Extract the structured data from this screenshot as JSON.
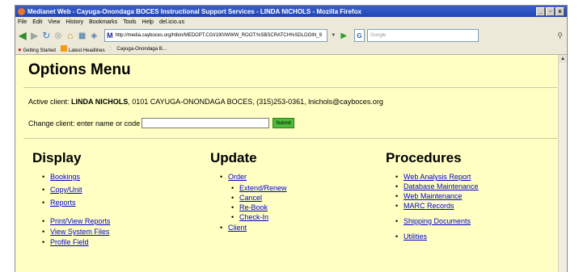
{
  "window": {
    "title": "Medianet Web - Cayuga-Onondaga BOCES Instructional Support Services - LINDA NICHOLS - Mozilla Firefox",
    "controls": [
      "_",
      "▫",
      "x"
    ]
  },
  "menubar": [
    "File",
    "Edit",
    "View",
    "History",
    "Bookmarks",
    "Tools",
    "Help",
    "del.icio.us"
  ],
  "toolbar": {
    "url": "http://media.cayboces.org/htbin/MEDOPT.CGI/190/WWW_ROOT:%SBSCRATCH%SDLOGIN_9",
    "search_placeholder": "Google"
  },
  "bookmarks": [
    "Getting Started",
    "Latest Headlines",
    "Cayuga-Onondaga B..."
  ],
  "page": {
    "title": "Options Menu",
    "active_client_label": "Active client:",
    "active_client_name": "LINDA NICHOLS",
    "active_client_details": ", 0101 CAYUGA-ONONDAGA BOCES, (315)253-0361, lnichols@cayboces.org",
    "change_client_label": "Change client: enter name or code",
    "change_client_value": "",
    "submit_label": "Submit"
  },
  "columns": {
    "display": {
      "heading": "Display",
      "items": [
        "Bookings",
        "Copy/Unit",
        "Reports",
        "Print/View Reports",
        "View System Files",
        "Profile Field"
      ]
    },
    "update": {
      "heading": "Update",
      "items": [
        "Order",
        "Extend/Renew",
        "Cancel",
        "Re-Book",
        "Check-In",
        "Client"
      ]
    },
    "procedures": {
      "heading": "Procedures",
      "items": [
        "Web Analysis Report",
        "Database Maintenance",
        "Web Maintenance",
        "MARC Records",
        "Shipping Documents",
        "Utilities"
      ]
    }
  },
  "colors": {
    "page_background": "#ffffc4",
    "link": "#0000cc",
    "submit_button": "#4cbd38",
    "titlebar": "#1f45b5"
  }
}
